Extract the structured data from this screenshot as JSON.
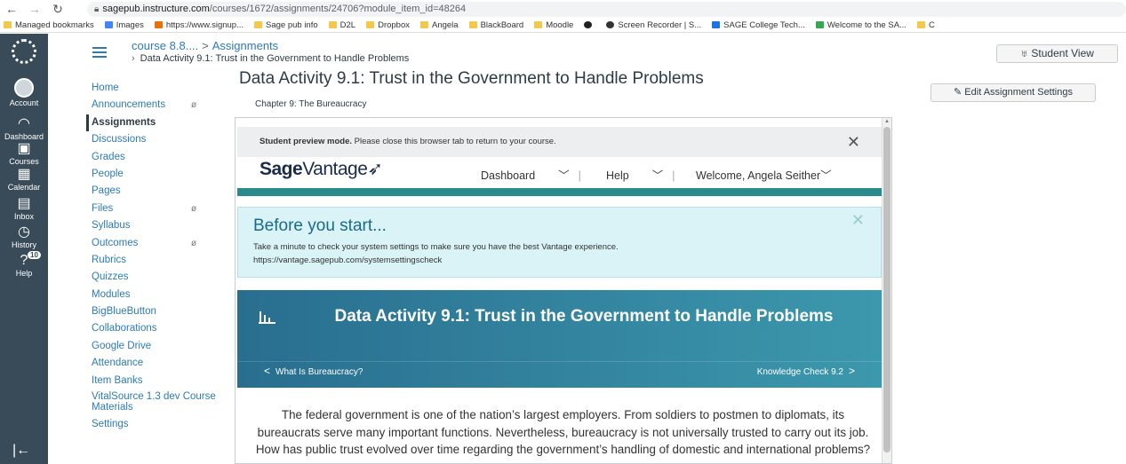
{
  "browser": {
    "url_host": "sagepub.instructure.com",
    "url_path": "/courses/1672/assignments/24706?module_item_id=48264"
  },
  "bookmarks": [
    {
      "label": "Managed bookmarks",
      "icon": "folder-icon"
    },
    {
      "label": "Images",
      "icon": "google-icon"
    },
    {
      "label": "https://www.signup...",
      "icon": "signup-icon"
    },
    {
      "label": "Sage pub info",
      "icon": "folder-icon"
    },
    {
      "label": "D2L",
      "icon": "folder-icon"
    },
    {
      "label": "Dropbox",
      "icon": "folder-icon"
    },
    {
      "label": "Angela",
      "icon": "folder-icon"
    },
    {
      "label": "BlackBoard",
      "icon": "folder-icon"
    },
    {
      "label": "Moodle",
      "icon": "folder-icon"
    },
    {
      "label": "",
      "icon": "github-icon"
    },
    {
      "label": "Screen Recorder | S...",
      "icon": "recorder-icon"
    },
    {
      "label": "SAGE College Tech...",
      "icon": "sage-icon"
    },
    {
      "label": "Welcome to the SA...",
      "icon": "sage-s-icon"
    },
    {
      "label": "C",
      "icon": "folder-icon"
    }
  ],
  "global_nav": [
    {
      "label": "Account",
      "icon": "avatar"
    },
    {
      "label": "Dashboard",
      "icon": "dashboard-icon"
    },
    {
      "label": "Courses",
      "icon": "courses-icon"
    },
    {
      "label": "Calendar",
      "icon": "calendar-icon"
    },
    {
      "label": "Inbox",
      "icon": "inbox-icon"
    },
    {
      "label": "History",
      "icon": "history-icon"
    },
    {
      "label": "Help",
      "icon": "help-icon",
      "badge": "10"
    }
  ],
  "breadcrumb": {
    "course": "course 8.8....",
    "assignments": "Assignments",
    "current": "Data Activity 9.1: Trust in the Government to Handle Problems"
  },
  "student_view_label": "Student View",
  "course_nav": [
    {
      "label": "Home"
    },
    {
      "label": "Announcements",
      "hidden": true
    },
    {
      "label": "Assignments",
      "active": true
    },
    {
      "label": "Discussions"
    },
    {
      "label": "Grades"
    },
    {
      "label": "People"
    },
    {
      "label": "Pages"
    },
    {
      "label": "Files",
      "hidden": true
    },
    {
      "label": "Syllabus"
    },
    {
      "label": "Outcomes",
      "hidden": true
    },
    {
      "label": "Rubrics"
    },
    {
      "label": "Quizzes"
    },
    {
      "label": "Modules"
    },
    {
      "label": "BigBlueButton"
    },
    {
      "label": "Collaborations"
    },
    {
      "label": "Google Drive"
    },
    {
      "label": "Attendance"
    },
    {
      "label": "Item Banks"
    },
    {
      "label": "VitalSource 1.3 dev Course Materials"
    },
    {
      "label": "Settings"
    }
  ],
  "assignment": {
    "title": "Data Activity 9.1: Trust in the Government to Handle Problems",
    "chapter": "Chapter 9: The Bureaucracy",
    "edit_label": "Edit Assignment Settings"
  },
  "vantage": {
    "preview_bold": "Student preview mode.",
    "preview_text": " Please close this browser tab to return to your course.",
    "logo_bold": "Sage",
    "logo_light": "Vantage",
    "nav_dashboard": "Dashboard",
    "nav_help": "Help",
    "nav_welcome": "Welcome, Angela Seither",
    "before_title": "Before you start...",
    "before_text": "Take a minute to check your system settings to make sure you have the best Vantage experience. https://vantage.sagepub.com/systemsettingscheck",
    "hero_title": "Data Activity 9.1: Trust in the Government to Handle Problems",
    "prev_label": "What Is Bureaucracy?",
    "next_label": "Knowledge Check 9.2",
    "intro": "The federal government is one of the nation’s largest employers. From soldiers to postmen to diplomats, its bureaucrats serve many important functions. Nevertheless, bureaucracy is not universally trusted to carry out its job. How has public trust evolved over time regarding the government’s handling of domestic and international problems?"
  },
  "colors": {
    "global_nav": "#394b58",
    "link": "#2c7bb6",
    "hero_start": "#296e8f",
    "hero_end": "#3c98ad",
    "teal_bar": "#2b8a8c"
  }
}
